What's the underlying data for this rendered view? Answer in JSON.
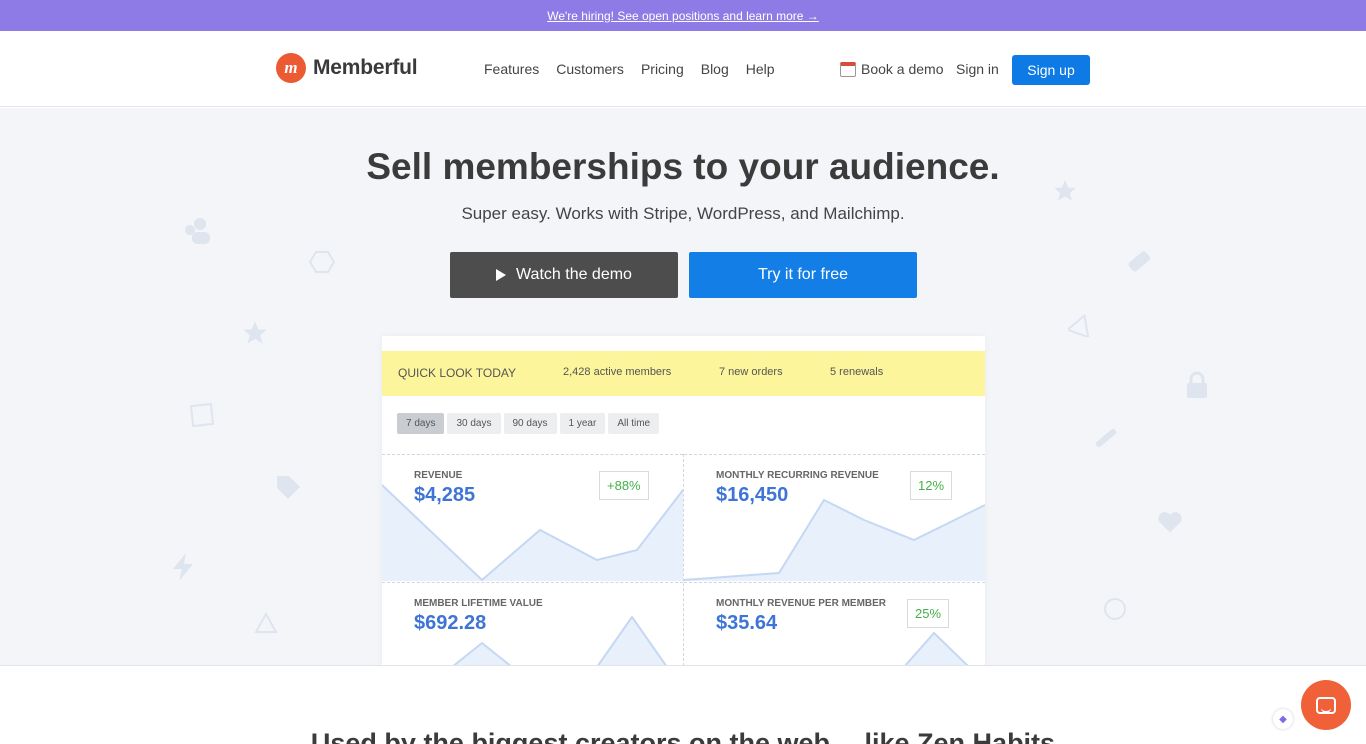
{
  "announcement": {
    "text": "We're hiring! See open positions and learn more →"
  },
  "nav": {
    "brand": "Memberful",
    "brand_mark": "m",
    "links": [
      "Features",
      "Customers",
      "Pricing",
      "Blog",
      "Help"
    ],
    "book_demo": "Book a demo",
    "sign_in": "Sign in",
    "sign_up": "Sign up"
  },
  "hero": {
    "title": "Sell memberships to your audience.",
    "subtitle": "Super easy. Works with Stripe, WordPress, and Mailchimp.",
    "watch_demo": "Watch the demo",
    "try_free": "Try it for free"
  },
  "dashboard": {
    "quick_look": "QUICK LOOK TODAY",
    "stats": [
      "2,428 active members",
      "7 new orders",
      "5 renewals"
    ],
    "ranges": [
      "7 days",
      "30 days",
      "90 days",
      "1 year",
      "All time"
    ],
    "active_range": "7 days",
    "cards": [
      {
        "label": "REVENUE",
        "value": "$4,285",
        "badge": "+88%"
      },
      {
        "label": "MONTHLY RECURRING REVENUE",
        "value": "$16,450",
        "badge": "12%"
      },
      {
        "label": "MEMBER LIFETIME VALUE",
        "value": "$692.28",
        "badge": ""
      },
      {
        "label": "MONTHLY REVENUE PER MEMBER",
        "value": "$35.64",
        "badge": "25%"
      }
    ]
  },
  "below_heading": "Used by the biggest creators on the web… like Zen Habits",
  "colors": {
    "accent": "#127ee6",
    "topbar": "#8f7be6",
    "brand": "#ec5a34",
    "highlight": "#fcf59b"
  },
  "icons": [
    "calendar-icon",
    "play-icon",
    "chat-icon",
    "clickup-icon"
  ]
}
